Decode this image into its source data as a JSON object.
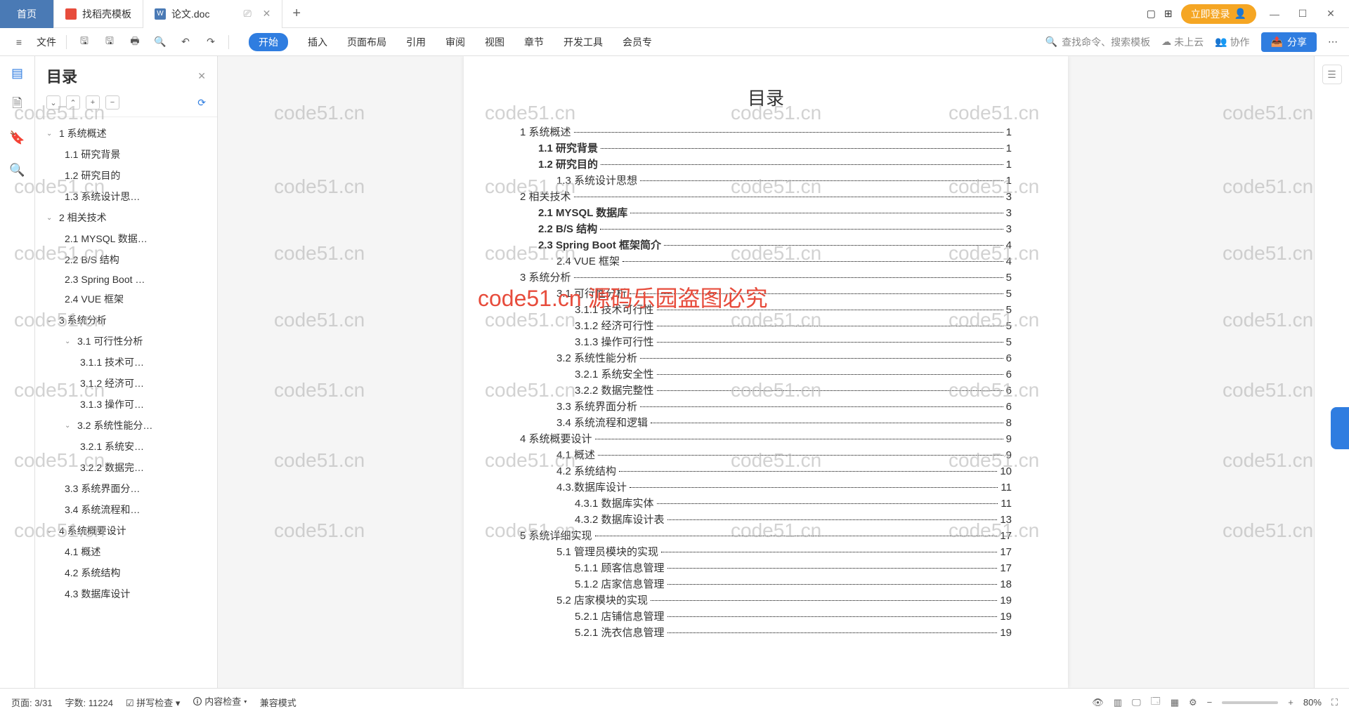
{
  "tabs": {
    "home": "首页",
    "t1": "找稻壳模板",
    "t2": "论文.doc",
    "screencast_icon": "⎚",
    "close": "✕",
    "plus": "+"
  },
  "titlebar_right": {
    "box_icon": "▢",
    "grid_icon": "⊞",
    "login": "立即登录",
    "avatar": "👤",
    "min": "—",
    "max": "☐",
    "close": "✕"
  },
  "toolbar": {
    "menu": "≡",
    "file": "文件",
    "save": "🖫",
    "saveas": "🖫",
    "print": "🖶",
    "preview": "🔍",
    "undo": "↶",
    "redo": "↷",
    "search_label": "查找命令、搜索模板",
    "cloud": "未上云",
    "collab": "协作",
    "share": "分享",
    "more": "⋯"
  },
  "ribbon": [
    "开始",
    "插入",
    "页面布局",
    "引用",
    "审阅",
    "视图",
    "章节",
    "开发工具",
    "会员专"
  ],
  "nav": {
    "title": "目录",
    "close": "✕",
    "tools": [
      "⌄",
      "⌃",
      "+",
      "−"
    ],
    "sync": "⟳"
  },
  "tree": [
    {
      "l": 1,
      "c": true,
      "t": "1 系统概述"
    },
    {
      "l": 2,
      "t": "1.1 研究背景"
    },
    {
      "l": 2,
      "t": "1.2 研究目的"
    },
    {
      "l": 2,
      "t": "1.3 系统设计思…"
    },
    {
      "l": 1,
      "c": true,
      "t": "2 相关技术"
    },
    {
      "l": 2,
      "t": "2.1 MYSQL 数据…"
    },
    {
      "l": 2,
      "t": "2.2 B/S 结构"
    },
    {
      "l": 2,
      "t": "2.3 Spring Boot …"
    },
    {
      "l": 2,
      "t": "2.4 VUE 框架"
    },
    {
      "l": 1,
      "c": true,
      "t": "3 系统分析"
    },
    {
      "l": 2,
      "c": true,
      "t": "3.1 可行性分析"
    },
    {
      "l": 3,
      "t": "3.1.1 技术可…"
    },
    {
      "l": 3,
      "t": "3.1.2 经济可…"
    },
    {
      "l": 3,
      "t": "3.1.3 操作可…"
    },
    {
      "l": 2,
      "c": true,
      "t": "3.2 系统性能分…"
    },
    {
      "l": 3,
      "t": "3.2.1 系统安…"
    },
    {
      "l": 3,
      "t": "3.2.2 数据完…"
    },
    {
      "l": 2,
      "t": "3.3 系统界面分…"
    },
    {
      "l": 2,
      "t": "3.4 系统流程和…"
    },
    {
      "l": 1,
      "c": true,
      "t": "4 系统概要设计"
    },
    {
      "l": 2,
      "t": "4.1 概述"
    },
    {
      "l": 2,
      "t": "4.2 系统结构"
    },
    {
      "l": 2,
      "t": "4.3 数据库设计"
    }
  ],
  "doc": {
    "title": "目录",
    "toc": [
      {
        "l": 0,
        "t": "1 系统概述",
        "p": "1"
      },
      {
        "l": 1,
        "t": "1.1  研究背景",
        "p": "1"
      },
      {
        "l": 1,
        "t": "1.2 研究目的",
        "p": "1"
      },
      {
        "l": 2,
        "t": "1.3 系统设计思想",
        "p": "1"
      },
      {
        "l": 0,
        "t": "2 相关技术",
        "p": "3"
      },
      {
        "l": 1,
        "t": "2.1 MYSQL 数据库",
        "p": "3"
      },
      {
        "l": 1,
        "t": "2.2 B/S 结构",
        "p": "3"
      },
      {
        "l": 1,
        "t": "2.3 Spring Boot 框架简介",
        "p": "4"
      },
      {
        "l": 2,
        "t": "2.4 VUE 框架",
        "p": "4"
      },
      {
        "l": 0,
        "t": "3 系统分析",
        "p": "5"
      },
      {
        "l": 2,
        "t": "3.1 可行性分析",
        "p": "5"
      },
      {
        "l": 3,
        "t": "3.1.1 技术可行性",
        "p": "5"
      },
      {
        "l": 3,
        "t": "3.1.2 经济可行性",
        "p": "5"
      },
      {
        "l": 3,
        "t": "3.1.3 操作可行性",
        "p": "5"
      },
      {
        "l": 2,
        "t": "3.2 系统性能分析",
        "p": "6"
      },
      {
        "l": 3,
        "t": "3.2.1 系统安全性",
        "p": "6"
      },
      {
        "l": 3,
        "t": "3.2.2 数据完整性",
        "p": "6"
      },
      {
        "l": 2,
        "t": "3.3 系统界面分析",
        "p": "6"
      },
      {
        "l": 2,
        "t": "3.4 系统流程和逻辑",
        "p": "8"
      },
      {
        "l": 0,
        "t": "4 系统概要设计",
        "p": "9"
      },
      {
        "l": 2,
        "t": "4.1 概述",
        "p": "9"
      },
      {
        "l": 2,
        "t": "4.2 系统结构",
        "p": "10"
      },
      {
        "l": 2,
        "t": "4.3.数据库设计",
        "p": "11"
      },
      {
        "l": 3,
        "t": "4.3.1 数据库实体",
        "p": "11"
      },
      {
        "l": 3,
        "t": "4.3.2 数据库设计表",
        "p": "13"
      },
      {
        "l": 0,
        "t": "5 系统详细实现",
        "p": "17"
      },
      {
        "l": 2,
        "t": "5.1 管理员模块的实现",
        "p": "17"
      },
      {
        "l": 3,
        "t": "5.1.1 顾客信息管理",
        "p": "17"
      },
      {
        "l": 3,
        "t": "5.1.2 店家信息管理",
        "p": "18"
      },
      {
        "l": 2,
        "t": "5.2 店家模块的实现",
        "p": "19"
      },
      {
        "l": 3,
        "t": "5.2.1 店铺信息管理",
        "p": "19"
      },
      {
        "l": 3,
        "t": "5.2.1 洗衣信息管理",
        "p": "19"
      }
    ]
  },
  "status": {
    "page": "页面: 3/31",
    "words": "字数: 11224",
    "spell": "拼写检查",
    "content": "内容检查",
    "compat": "兼容模式",
    "zoom": "80%"
  },
  "watermarks": {
    "grey": "code51.cn",
    "red": "code51.cn 源码乐园盗图必究"
  }
}
